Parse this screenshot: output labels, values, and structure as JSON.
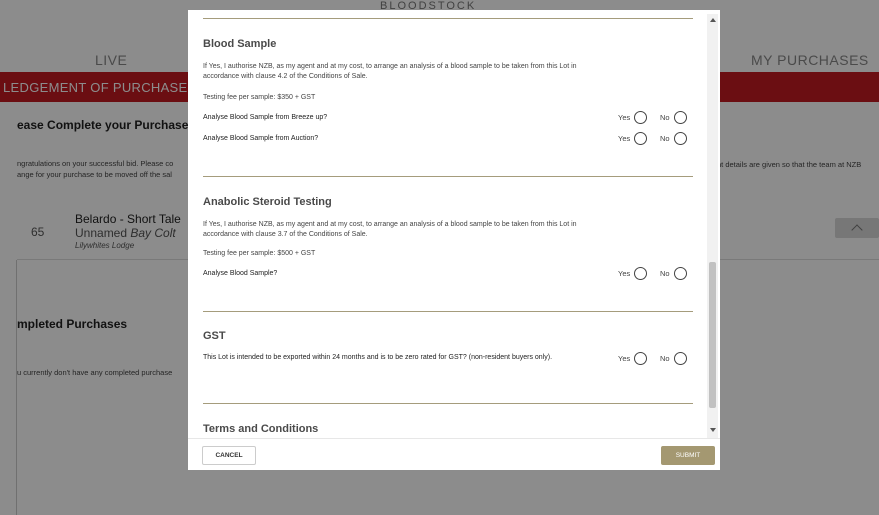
{
  "background": {
    "top_title": "BLOODSTOCK",
    "tab_live": "LIVE",
    "tab_my_purchases": "MY PURCHASES",
    "red_banner": "LEDGEMENT OF PURCHASE AN",
    "complete_title": "ease Complete your Purchase",
    "congrats_line1": "ngratulations on your successful bid. Please co",
    "congrats_line2": "ange for your purchase to be moved off the sal",
    "congrats_right": "nt details are given so that the team at NZB",
    "lot": {
      "number": "65",
      "name": "Belardo - Short Tale",
      "sub_plain": "Unnamed ",
      "sub_italic": "Bay Colt",
      "vendor": "Lilywhites Lodge"
    },
    "completed_title": "mpleted Purchases",
    "no_completed": "u currently don't have any completed purchase"
  },
  "modal": {
    "blood_sample": {
      "title": "Blood Sample",
      "body": "If Yes, I authorise NZB, as my agent and at my cost, to arrange an analysis of a blood sample to be taken from this Lot in accordance with clause 4.2 of the Conditions of Sale.",
      "fee": "Testing fee per sample: $350 + GST",
      "q1": "Analyse Blood Sample from Breeze up?",
      "q2": "Analyse Blood Sample from Auction?"
    },
    "anabolic": {
      "title": "Anabolic Steroid Testing",
      "body": "If Yes, I authorise NZB, as my agent and at my cost, to arrange an analysis of a blood sample to be taken from this Lot in accordance with clause 3.7 of the Conditions of Sale.",
      "fee": "Testing fee per sample: $500 + GST",
      "q1": "Analyse Blood Sample?"
    },
    "gst": {
      "title": "GST",
      "q1": "This Lot is intended to be exported within 24 months and is to be zero rated for GST? (non-resident buyers only)."
    },
    "terms": {
      "title": "Terms and Conditions"
    },
    "radio_yes": "Yes",
    "radio_no": "No",
    "cancel_label": "CANCEL",
    "submit_label": "SUBMIT"
  }
}
